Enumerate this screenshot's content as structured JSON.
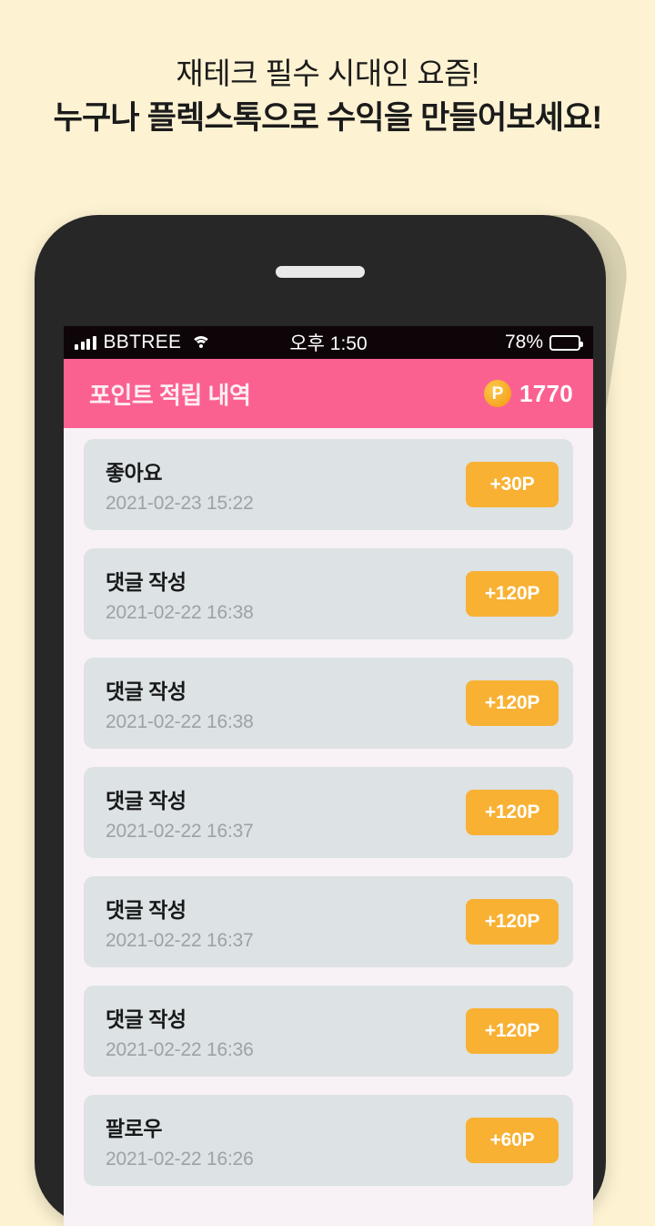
{
  "promo": {
    "line1": "재테크 필수 시대인 요즘!",
    "line2": "누구나 플렉스톡으로 수익을 만들어보세요!"
  },
  "status_bar": {
    "carrier": "BBTREE",
    "wifi_icon": "wifi-icon",
    "signal_icon": "signal-bars-icon",
    "time": "오후 1:50",
    "battery_percent": "78%",
    "battery_level": 78
  },
  "app_header": {
    "title": "포인트 적립 내역",
    "coin_icon_label": "P",
    "points": "1770",
    "background_color": "#fb6190"
  },
  "colors": {
    "page_background": "#fdf2d2",
    "phone_body": "#272727",
    "shadow": "#d6cfb0",
    "screen_background": "#f8f2f6",
    "card_background": "#dde2e4",
    "badge_orange": "#f8b133",
    "accent_pink": "#fb6190"
  },
  "list": {
    "items": [
      {
        "title": "좋아요",
        "date": "2021-02-23 15:22",
        "points": "+30P"
      },
      {
        "title": "댓글 작성",
        "date": "2021-02-22 16:38",
        "points": "+120P"
      },
      {
        "title": "댓글 작성",
        "date": "2021-02-22 16:38",
        "points": "+120P"
      },
      {
        "title": "댓글 작성",
        "date": "2021-02-22 16:37",
        "points": "+120P"
      },
      {
        "title": "댓글 작성",
        "date": "2021-02-22 16:37",
        "points": "+120P"
      },
      {
        "title": "댓글 작성",
        "date": "2021-02-22 16:36",
        "points": "+120P"
      },
      {
        "title": "팔로우",
        "date": "2021-02-22 16:26",
        "points": "+60P"
      }
    ]
  }
}
